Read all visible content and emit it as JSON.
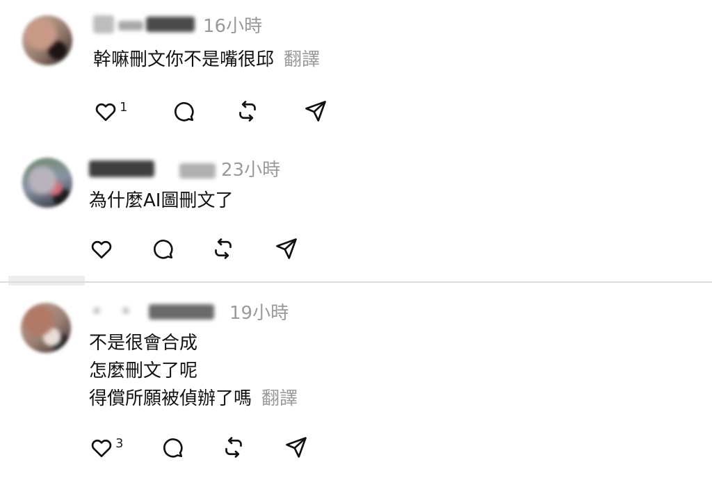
{
  "comments": [
    {
      "time": "16小時",
      "text": [
        "幹嘛刪文你不是嘴很邱"
      ],
      "translate": "翻譯",
      "likes": "1"
    },
    {
      "time": "23小時",
      "text": [
        "為什麼AI圖刪文了"
      ],
      "translate": "",
      "likes": ""
    },
    {
      "time": "19小時",
      "text": [
        "不是很會合成",
        "怎麼刪文了呢",
        "得償所願被偵辦了嗎"
      ],
      "translate": "翻譯",
      "likes": "3"
    }
  ],
  "icons": [
    "heart-icon",
    "comment-icon",
    "repost-icon",
    "share-icon"
  ]
}
